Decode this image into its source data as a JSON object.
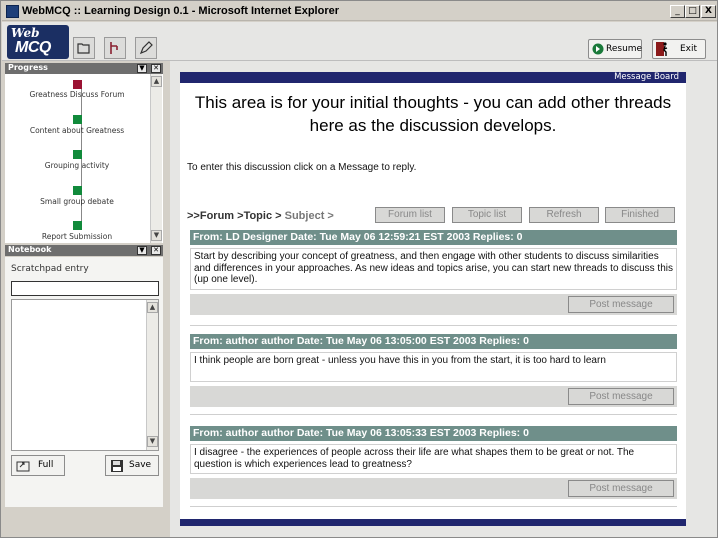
{
  "window": {
    "title": "WebMCQ :: Learning Design 0.1 - Microsoft Internet Explorer",
    "controls": {
      "minimize": "_",
      "maximize": "□",
      "close": "X"
    }
  },
  "toolbar": {
    "logo_line1": "Web",
    "logo_line2": "MCQ",
    "icons": [
      "folder-icon",
      "pointer-icon",
      "pencil-icon"
    ],
    "resume_label": "Resume",
    "exit_label": "Exit"
  },
  "progress": {
    "title": "Progress",
    "activities": [
      {
        "label": "Greatness Discuss Forum",
        "status": "current",
        "color": "#9b1233"
      },
      {
        "label": "Content about Greatness",
        "status": "todo",
        "color": "#118a3b"
      },
      {
        "label": "Grouping activity",
        "status": "todo",
        "color": "#118a3b"
      },
      {
        "label": "Small group debate",
        "status": "todo",
        "color": "#118a3b"
      },
      {
        "label": "Report Submission",
        "status": "todo",
        "color": "#118a3b"
      }
    ]
  },
  "notebook": {
    "title": "Notebook",
    "scratch_label": "Scratchpad entry",
    "scratch_value": "",
    "body_value": "",
    "full_label": "Full",
    "save_label": "Save"
  },
  "board": {
    "header": "Message Board",
    "intro": "This area is for your initial thoughts - you can add other threads here as the discussion develops.",
    "instruction": "To enter this discussion click on a Message to reply.",
    "crumb_forum": ">>Forum",
    "crumb_topic": ">Topic >",
    "crumb_subject": "Subject >",
    "buttons": {
      "forum_list": "Forum list",
      "topic_list": "Topic list",
      "refresh": "Refresh",
      "finished": "Finished"
    },
    "messages": [
      {
        "header": "From: LD Designer   Date: Tue May 06 12:59:21 EST 2003   Replies: 0",
        "body": "Start by describing your concept of greatness, and then engage with other students to discuss similarities and differences in your approaches. As new ideas and topics arise, you can start new threads to discuss this (up one level).",
        "button": "Post message"
      },
      {
        "header": "From: author author   Date: Tue May 06 13:05:00 EST 2003   Replies: 0",
        "body": "I think people are born great - unless you have this in you from the start, it is too hard to learn",
        "button": "Post message"
      },
      {
        "header": "From: author author   Date: Tue May 06 13:05:33 EST 2003   Replies: 0",
        "body": "I disagree - the experiences of people across their life are what shapes them to be great or not. The question is which experiences lead to greatness?",
        "button": "Post message"
      }
    ]
  }
}
